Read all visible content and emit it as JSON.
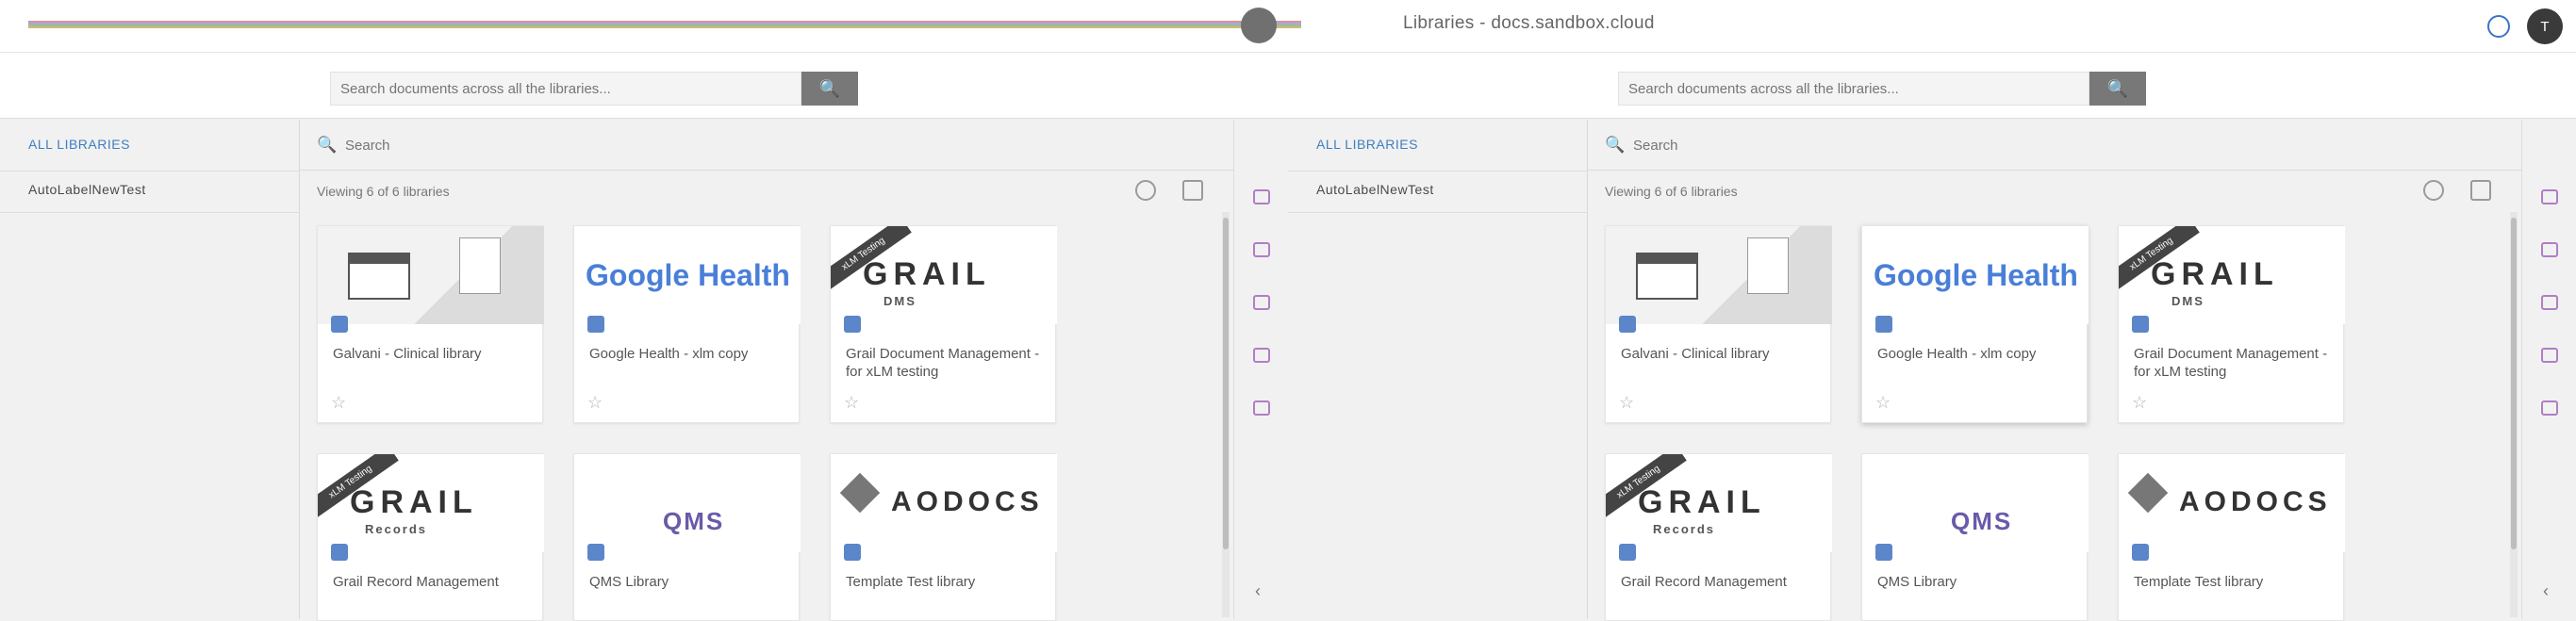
{
  "app": {
    "title": "Libraries - docs.sandbox.cloud",
    "avatar_initial": "T"
  },
  "icons": {
    "menu": "menu-icon",
    "help": "help-icon",
    "search": "search-icon",
    "filter": "filter-search-icon",
    "star": "star-icon",
    "view_grid": "grid-view-icon",
    "view_list": "list-view-icon",
    "collapse": "chevron-left-icon"
  },
  "colors": {
    "accent": "#3e7fbf",
    "search_button": "#787878",
    "rail_icon": "#b07fc4"
  },
  "panes": [
    {
      "search_placeholder": "Search documents across all the libraries...",
      "nav": {
        "all_label": "ALL LIBRARIES",
        "sub_label": "AutoLabelNewTest"
      },
      "filter_placeholder": "Search",
      "viewing": "Viewing 6 of 6 libraries",
      "star_glyph": "☆",
      "collapse_glyph": "‹",
      "cards": [
        {
          "name": "Galvani - Clinical library",
          "thumb": "calendar"
        },
        {
          "name": "Google Health - xlm copy",
          "thumb": "google",
          "logo": "Google Health"
        },
        {
          "name": "Grail Document Management - for xLM testing",
          "thumb": "grail",
          "logo": "GRAIL",
          "logo_sub": "DMS",
          "banner": "xLM Testing"
        },
        {
          "name": "Grail Record Management",
          "thumb": "grail",
          "logo": "GRAIL",
          "logo_sub": "Records",
          "banner": "xLM Testing"
        },
        {
          "name": "QMS Library",
          "thumb": "qms",
          "logo": "QMS"
        },
        {
          "name": "Template Test library",
          "thumb": "aodocs",
          "logo": "AODOCS"
        }
      ]
    },
    {
      "search_placeholder": "Search documents across all the libraries...",
      "nav": {
        "all_label": "ALL LIBRARIES",
        "sub_label": "AutoLabelNewTest"
      },
      "filter_placeholder": "Search",
      "viewing": "Viewing 6 of 6 libraries",
      "star_glyph": "☆",
      "collapse_glyph": "‹",
      "cards": [
        {
          "name": "Galvani - Clinical library",
          "thumb": "calendar"
        },
        {
          "name": "Google Health - xlm copy",
          "thumb": "google",
          "logo": "Google Health"
        },
        {
          "name": "Grail Document Management - for xLM testing",
          "thumb": "grail",
          "logo": "GRAIL",
          "logo_sub": "DMS",
          "banner": "xLM Testing"
        },
        {
          "name": "Grail Record Management",
          "thumb": "grail",
          "logo": "GRAIL",
          "logo_sub": "Records",
          "banner": "xLM Testing"
        },
        {
          "name": "QMS Library",
          "thumb": "qms",
          "logo": "QMS"
        },
        {
          "name": "Template Test library",
          "thumb": "aodocs",
          "logo": "AODOCS"
        }
      ]
    }
  ]
}
